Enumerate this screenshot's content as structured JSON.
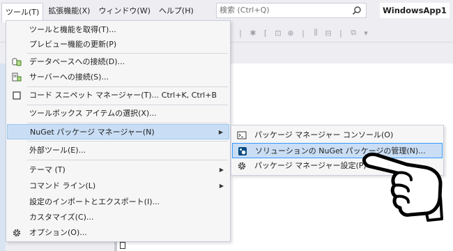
{
  "menubar": {
    "items": [
      {
        "label": "ツール(T)",
        "active": true
      },
      {
        "label": "拡張機能(X)"
      },
      {
        "label": "ウィンドウ(W)"
      },
      {
        "label": "ヘルプ(H)"
      }
    ],
    "search_placeholder": "検索 (Ctrl+Q)",
    "app_title": "WindowsApp1"
  },
  "tools_menu": {
    "items": [
      {
        "label": "ツールと機能を取得(T)..."
      },
      {
        "label": "プレビュー機能の更新(P)"
      },
      {
        "label": "データベースへの接続(D)...",
        "icon": "database-connect-icon"
      },
      {
        "label": "サーバーへの接続(S)...",
        "icon": "server-connect-icon"
      },
      {
        "label": "コード スニペット マネージャー(T)...",
        "shortcut": "Ctrl+K, Ctrl+B",
        "icon": "snippet-checkbox-icon"
      },
      {
        "label": "ツールボックス アイテムの選択(X)..."
      },
      {
        "label": "NuGet パッケージ マネージャー(N)",
        "submenu": true
      },
      {
        "label": "外部ツール(E)..."
      },
      {
        "label": "テーマ (T)",
        "submenu": true
      },
      {
        "label": "コマンド ライン(L)",
        "submenu": true
      },
      {
        "label": "設定のインポートとエクスポート(I)..."
      },
      {
        "label": "カスタマイズ(C)..."
      },
      {
        "label": "オプション(O)...",
        "icon": "gear-icon"
      }
    ]
  },
  "nuget_submenu": {
    "items": [
      {
        "label": "パッケージ マネージャー コンソール(O)",
        "icon": "console-icon"
      },
      {
        "label": "ソリューションの NuGet パッケージの管理(N)...",
        "icon": "nuget-icon"
      },
      {
        "label": "パッケージ マネージャー設定(P)",
        "icon": "gear-icon"
      }
    ]
  },
  "colors": {
    "highlight": "#c9def5",
    "highlight_border": "#3399ff",
    "menu_bg": "#f6f6f6",
    "chrome_bg": "#eeeef2"
  }
}
